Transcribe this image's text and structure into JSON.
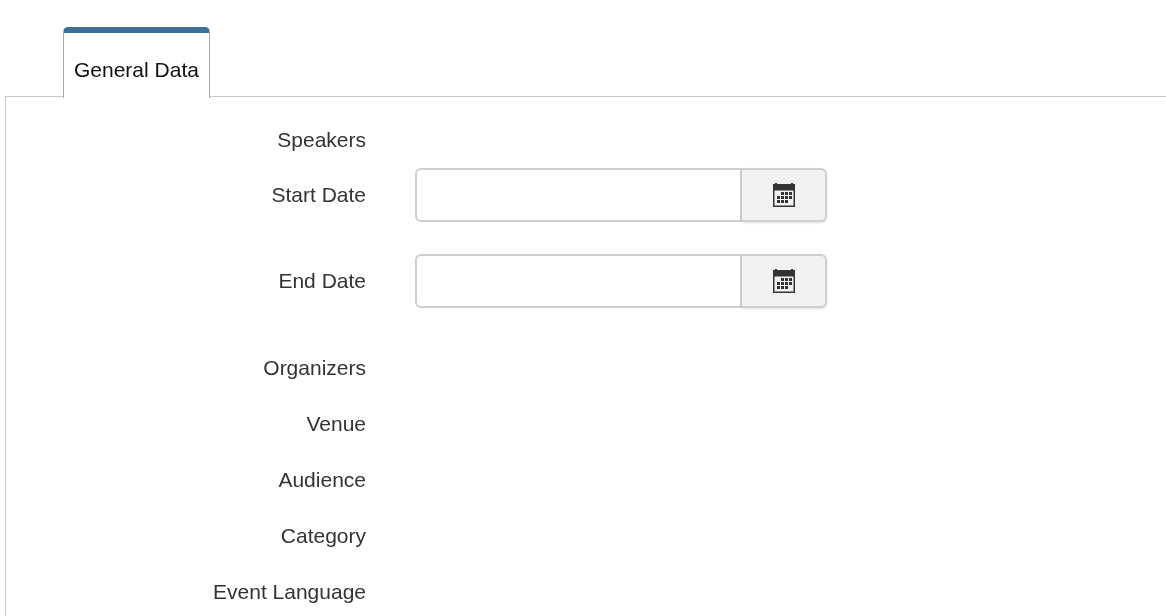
{
  "tabs": [
    {
      "label": "General Data",
      "selected": true
    }
  ],
  "fields": [
    {
      "label": "Speakers",
      "kind": "text"
    },
    {
      "label": "Start Date",
      "kind": "date"
    },
    {
      "label": "End Date",
      "kind": "date"
    },
    {
      "label": "Organizers",
      "kind": "text"
    },
    {
      "label": "Venue",
      "kind": "text"
    },
    {
      "label": "Audience",
      "kind": "text"
    },
    {
      "label": "Category",
      "kind": "text"
    },
    {
      "label": "Event Language",
      "kind": "text"
    }
  ]
}
